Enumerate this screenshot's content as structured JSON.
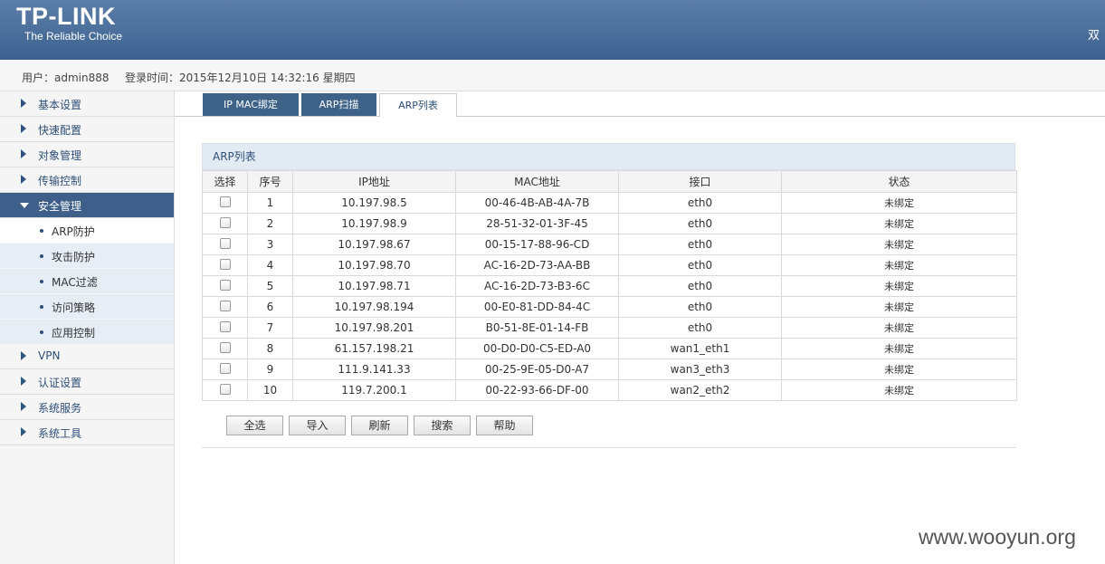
{
  "header": {
    "logo": "TP-LINK",
    "slogan": "The Reliable Choice",
    "right_text": "双",
    "bg_color": "#4a6d99"
  },
  "userbar": {
    "user": "用户：admin888",
    "login_time": "登录时间：2015年12月10日 14:32:16 星期四"
  },
  "sidebar": {
    "items": [
      {
        "label": "基本设置"
      },
      {
        "label": "快速配置"
      },
      {
        "label": "对象管理"
      },
      {
        "label": "传输控制"
      },
      {
        "label": "安全管理"
      },
      {
        "label": "VPN"
      },
      {
        "label": "认证设置"
      },
      {
        "label": "系统服务"
      },
      {
        "label": "系统工具"
      }
    ],
    "subitems": [
      {
        "label": "ARP防护"
      },
      {
        "label": "攻击防护"
      },
      {
        "label": "MAC过滤"
      },
      {
        "label": "访问策略"
      },
      {
        "label": "应用控制"
      }
    ]
  },
  "tabs": [
    {
      "label": "IP MAC绑定"
    },
    {
      "label": "ARP扫描"
    },
    {
      "label": "ARP列表"
    }
  ],
  "panel": {
    "title": "ARP列表",
    "columns": [
      "选择",
      "序号",
      "IP地址",
      "MAC地址",
      "接口",
      "状态"
    ],
    "rows": [
      {
        "no": "1",
        "ip": "10.197.98.5",
        "mac": "00-46-4B-AB-4A-7B",
        "iface": "eth0",
        "status": "未绑定"
      },
      {
        "no": "2",
        "ip": "10.197.98.9",
        "mac": "28-51-32-01-3F-45",
        "iface": "eth0",
        "status": "未绑定"
      },
      {
        "no": "3",
        "ip": "10.197.98.67",
        "mac": "00-15-17-88-96-CD",
        "iface": "eth0",
        "status": "未绑定"
      },
      {
        "no": "4",
        "ip": "10.197.98.70",
        "mac": "AC-16-2D-73-AA-BB",
        "iface": "eth0",
        "status": "未绑定"
      },
      {
        "no": "5",
        "ip": "10.197.98.71",
        "mac": "AC-16-2D-73-B3-6C",
        "iface": "eth0",
        "status": "未绑定"
      },
      {
        "no": "6",
        "ip": "10.197.98.194",
        "mac": "00-E0-81-DD-84-4C",
        "iface": "eth0",
        "status": "未绑定"
      },
      {
        "no": "7",
        "ip": "10.197.98.201",
        "mac": "B0-51-8E-01-14-FB",
        "iface": "eth0",
        "status": "未绑定"
      },
      {
        "no": "8",
        "ip": "61.157.198.21",
        "mac": "00-D0-D0-C5-ED-A0",
        "iface": "wan1_eth1",
        "status": "未绑定"
      },
      {
        "no": "9",
        "ip": "111.9.141.33",
        "mac": "00-25-9E-05-D0-A7",
        "iface": "wan3_eth3",
        "status": "未绑定"
      },
      {
        "no": "10",
        "ip": "119.7.200.1",
        "mac": "00-22-93-66-DF-00",
        "iface": "wan2_eth2",
        "status": "未绑定"
      }
    ]
  },
  "buttons": {
    "select_all": "全选",
    "import": "导入",
    "refresh": "刷新",
    "search": "搜索",
    "help": "帮助"
  },
  "watermark": "www.wooyun.org"
}
